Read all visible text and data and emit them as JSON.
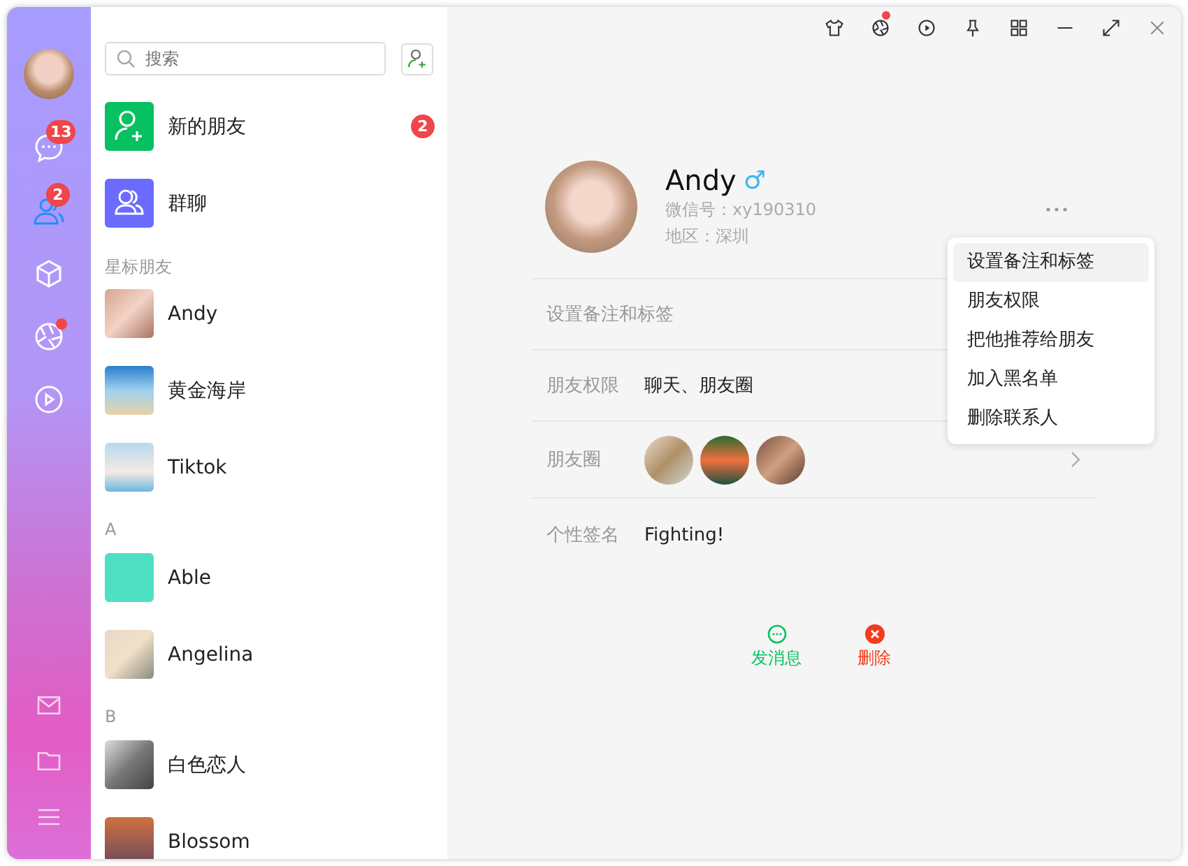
{
  "nav": {
    "items": [
      {
        "kind": "chat",
        "badge": "13",
        "selected": false
      },
      {
        "kind": "contacts",
        "badge": "2",
        "selected": true
      },
      {
        "kind": "box",
        "selected": false
      },
      {
        "kind": "aperture",
        "dot": true,
        "selected": false
      },
      {
        "kind": "play",
        "selected": false
      }
    ],
    "bottom": [
      {
        "kind": "mail"
      },
      {
        "kind": "folder"
      },
      {
        "kind": "menu"
      }
    ]
  },
  "search": {
    "placeholder": "搜索"
  },
  "contacts": [
    {
      "kind": "new",
      "name": "新的朋友",
      "badge": "2"
    },
    {
      "kind": "group",
      "name": "群聊"
    },
    {
      "kind": "header",
      "name": "星标朋友"
    },
    {
      "kind": "person",
      "name": "Andy"
    },
    {
      "kind": "person",
      "name": "黄金海岸"
    },
    {
      "kind": "person",
      "name": "Tiktok"
    },
    {
      "kind": "header",
      "name": "A"
    },
    {
      "kind": "person",
      "name": "Able"
    },
    {
      "kind": "person",
      "name": "Angelina"
    },
    {
      "kind": "header",
      "name": "B"
    },
    {
      "kind": "person",
      "name": "白色恋人"
    },
    {
      "kind": "person",
      "name": "Blossom"
    }
  ],
  "toolbar": [
    {
      "kind": "shirt"
    },
    {
      "kind": "aperture",
      "dot": true
    },
    {
      "kind": "play"
    },
    {
      "kind": "pin"
    },
    {
      "kind": "grid"
    },
    {
      "kind": "minimize"
    },
    {
      "kind": "maximize"
    },
    {
      "kind": "close"
    }
  ],
  "profile": {
    "name": "Andy",
    "gender": "♂",
    "wechat_id": "微信号：xy190310",
    "region": "地区：深圳"
  },
  "rows": [
    {
      "kind": "single",
      "label": "设置备注和标签"
    },
    {
      "kind": "text",
      "label": "朋友权限",
      "value": "聊天、朋友圈"
    },
    {
      "kind": "photos",
      "label": "朋友圈",
      "photos": [
        {
          "kind": "photo"
        },
        {
          "kind": "photo"
        },
        {
          "kind": "photo"
        }
      ]
    },
    {
      "kind": "text",
      "label": "个性签名",
      "value": "Fighting!"
    }
  ],
  "menu": [
    {
      "label": "设置备注和标签",
      "selected": true
    },
    {
      "label": "朋友权限",
      "selected": false
    },
    {
      "label": "把他推荐给朋友",
      "selected": false
    },
    {
      "label": "加入黑名单",
      "selected": false
    },
    {
      "label": "删除联系人",
      "selected": false
    }
  ],
  "actions": [
    {
      "kind": "message",
      "label": "发消息"
    },
    {
      "kind": "delete",
      "label": "删除"
    }
  ]
}
